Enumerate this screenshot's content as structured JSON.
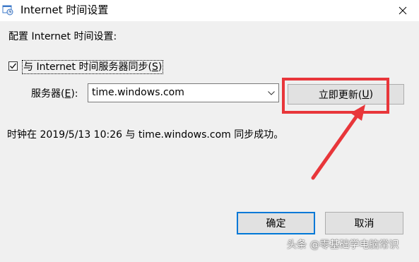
{
  "window": {
    "title": "Internet 时间设置",
    "title_icon": "clock-gear-icon",
    "close_icon": "close-icon"
  },
  "section_title": "配置 Internet 时间设置:",
  "sync_checkbox": {
    "checked": true,
    "label_prefix": "与 Internet 时间服务器同步(",
    "label_key": "S",
    "label_suffix": ")"
  },
  "server": {
    "label_prefix": "服务器(",
    "label_key": "E",
    "label_suffix": "):",
    "value": "time.windows.com"
  },
  "update_button": {
    "label_prefix": "立即更新(",
    "label_key": "U",
    "label_suffix": ")"
  },
  "status": "时钟在 2019/5/13 10:26 与 time.windows.com 同步成功。",
  "buttons": {
    "ok_label": "确定",
    "cancel_label": "取消"
  },
  "annotation": {
    "color": "#e8363a"
  },
  "watermark": "头条 @零基础学电脑常识",
  "colors": {
    "dialog_bg": "#f0f0f0",
    "button_bg": "#e1e1e1",
    "focus_border": "#0078d7"
  }
}
